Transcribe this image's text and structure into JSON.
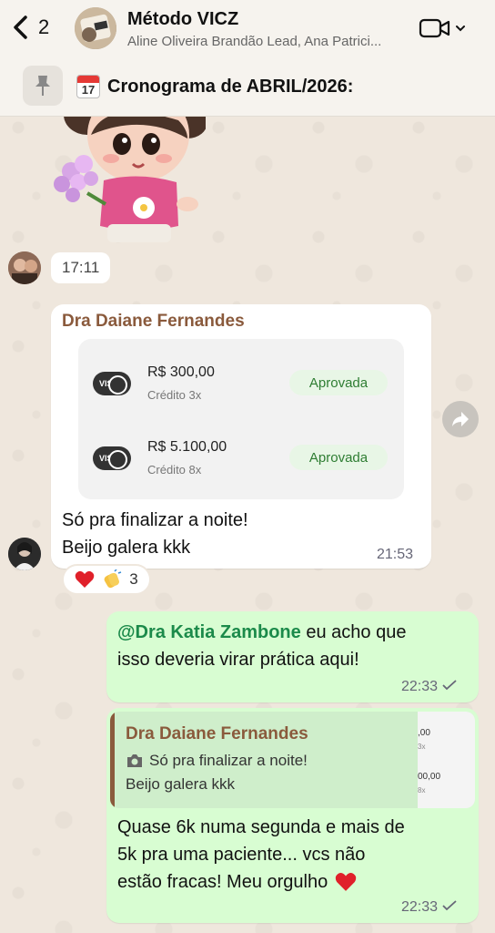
{
  "header": {
    "back_count": "2",
    "title": "Método VICZ",
    "subtitle": "Aline Oliveira Brandão Lead, Ana Patrici...",
    "pinned_date": "17",
    "pinned_text": "Cronograma de ABRIL/2026:"
  },
  "messages": {
    "sticker_time": "17:11",
    "incoming": {
      "sender": "Dra Daiane Fernandes",
      "payments": [
        {
          "card": "VISA",
          "amount": "R$ 300,00",
          "detail": "Crédito 3x",
          "status": "Aprovada"
        },
        {
          "card": "VISA",
          "amount": "R$ 5.100,00",
          "detail": "Crédito 8x",
          "status": "Aprovada"
        }
      ],
      "line1": "Só pra finalizar a noite!",
      "line2": "Beijo galera kkk",
      "time": "21:53",
      "reaction_count": "3"
    },
    "outgoing1": {
      "mention": "@Dra Katia Zambone",
      "text1": " eu acho que",
      "text2": "isso deveria virar prática aqui!",
      "time": "22:33"
    },
    "outgoing2": {
      "reply_sender": "Dra Daiane Fernandes",
      "reply_line1": "Só pra finalizar a noite!",
      "reply_line2": "Beijo galera kkk",
      "thumb_row1": ",00",
      "thumb_row1_sub": "3x",
      "thumb_row2": "00,00",
      "thumb_row2_sub": "8x",
      "line1": "Quase 6k numa segunda e mais de",
      "line2": "5k pra uma paciente... vcs não",
      "line3": "estão fracas! Meu orgulho",
      "time": "22:33"
    }
  },
  "colors": {
    "sender_name": "#8a5a3c",
    "mention": "#1b8a4a",
    "outgoing_bubble": "#d8fdd2",
    "approved": "#2e7d32"
  },
  "icons": [
    "back-chevron-icon",
    "video-call-icon",
    "pin-icon",
    "calendar-icon",
    "camera-icon",
    "forward-icon",
    "heart-icon",
    "clap-icon",
    "check-icon"
  ]
}
